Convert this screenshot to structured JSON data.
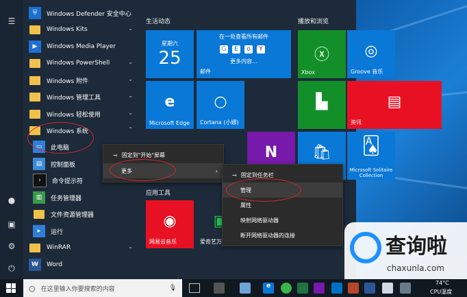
{
  "app_list": {
    "items": [
      {
        "label": "Windows Defender 安全中心",
        "icon": "shield-icon",
        "expandable": false
      },
      {
        "label": "Windows Kits",
        "icon": "folder-icon",
        "expandable": true
      },
      {
        "label": "Windows Media Player",
        "icon": "media-player-icon",
        "expandable": false
      },
      {
        "label": "Windows PowerShell",
        "icon": "folder-icon",
        "expandable": true
      },
      {
        "label": "Windows 附件",
        "icon": "folder-icon",
        "expandable": true
      },
      {
        "label": "Windows 管理工具",
        "icon": "folder-icon",
        "expandable": true
      },
      {
        "label": "Windows 轻松使用",
        "icon": "folder-icon",
        "expandable": true
      },
      {
        "label": "Windows 系统",
        "icon": "folder-icon",
        "expandable": true
      }
    ],
    "system_subitems": [
      {
        "label": "此电脑",
        "icon": "computer-icon"
      },
      {
        "label": "控制面板",
        "icon": "control-panel-icon"
      },
      {
        "label": "命令提示符",
        "icon": "cmd-icon"
      },
      {
        "label": "任务管理器",
        "icon": "task-manager-icon"
      },
      {
        "label": "文件资源管理器",
        "icon": "file-explorer-icon"
      },
      {
        "label": "运行",
        "icon": "run-icon"
      }
    ],
    "more_items": [
      {
        "label": "WinRAR",
        "icon": "folder-icon",
        "expandable": true
      },
      {
        "label": "Word",
        "icon": "word-icon",
        "expandable": false
      }
    ]
  },
  "tiles": {
    "group_life": "生活动态",
    "group_play": "播放和浏览",
    "group_apps": "应用工具",
    "calendar": {
      "weekday": "星期六",
      "day": "25"
    },
    "mail": {
      "headline": "在一处查看所有邮件",
      "more": "更多内容...",
      "label": "邮件"
    },
    "xbox": "Xbox",
    "groove": "Groove 音乐",
    "edge": "Microsoft Edge",
    "cortana": "Cortana (小娜)",
    "news": "资讯",
    "solitaire": "Microsoft Solitaire Collection",
    "netease": "网易云音乐",
    "photo": "爱奇艺万..."
  },
  "context_menu_1": {
    "pin_start": "固定到\"开始\"屏幕",
    "more": "更多"
  },
  "context_menu_2": {
    "pin_taskbar": "固定到任务栏",
    "manage": "管理",
    "properties": "属性",
    "map_drive": "映射网络驱动器",
    "disconnect_drive": "断开网络驱动器的连接"
  },
  "taskbar": {
    "search_placeholder": "在这里输入你要搜索的内容"
  },
  "tray": {
    "temp": "74°C",
    "temp_label": "CPU温度"
  },
  "watermark": {
    "brand": "查询啦",
    "domain": "chaxunla.com"
  },
  "colors": {
    "tile_blue": "#0a78d7",
    "tile_green": "#128f29",
    "tile_red": "#e81123",
    "tile_purple": "#7719aa",
    "highlight_oval": "#d9262b"
  }
}
